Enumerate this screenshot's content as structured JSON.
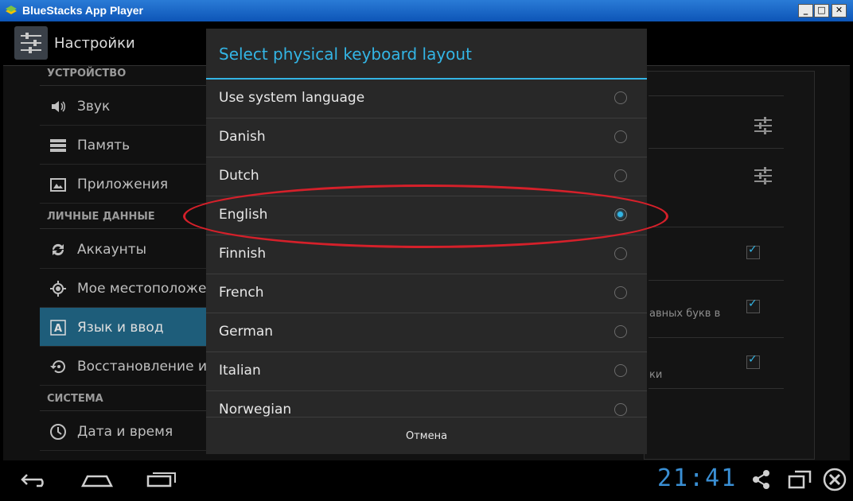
{
  "window": {
    "title": "BlueStacks App Player"
  },
  "actionbar": {
    "title": "Настройки"
  },
  "settings": {
    "cat_device": "УСТРОЙСТВО",
    "cat_personal": "ЛИЧНЫЕ ДАННЫЕ",
    "cat_system": "СИСТЕМА",
    "items": [
      {
        "label": "Звук"
      },
      {
        "label": "Память"
      },
      {
        "label": "Приложения"
      },
      {
        "label": "Аккаунты"
      },
      {
        "label": "Мое местоположен"
      },
      {
        "label": "Язык и ввод"
      },
      {
        "label": "Восстановление и с"
      },
      {
        "label": "Дата и время"
      }
    ]
  },
  "background_right": {
    "text1": "авных букв в",
    "text2": "ки"
  },
  "dialog": {
    "title": "Select physical keyboard layout",
    "options": [
      {
        "label": "Use system language",
        "selected": false
      },
      {
        "label": "Danish",
        "selected": false
      },
      {
        "label": "Dutch",
        "selected": false
      },
      {
        "label": "English",
        "selected": true
      },
      {
        "label": "Finnish",
        "selected": false
      },
      {
        "label": "French",
        "selected": false
      },
      {
        "label": "German",
        "selected": false
      },
      {
        "label": "Italian",
        "selected": false
      },
      {
        "label": "Norwegian",
        "selected": false
      }
    ],
    "cancel_label": "Отмена"
  },
  "statusbar": {
    "clock": "21:41"
  },
  "colors": {
    "accent": "#33b5e5",
    "highlight": "#d5202a",
    "selected_item": "#1e5d7a"
  }
}
